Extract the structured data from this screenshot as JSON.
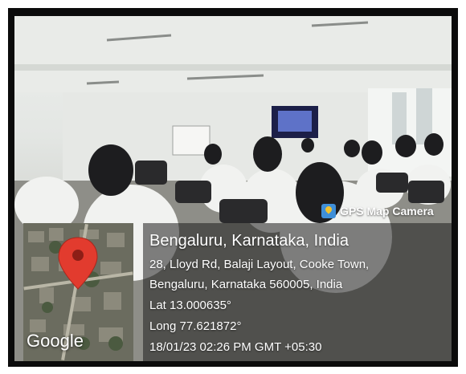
{
  "camera": {
    "app_name": "GPS Map Camera",
    "icon": "gps-map-camera-icon"
  },
  "map": {
    "provider_label": "Google",
    "pin_icon": "map-pin-icon",
    "pin_color": "#e23b2e"
  },
  "location": {
    "title": "Bengaluru, Karnataka, India",
    "address_line1": "28, Lloyd Rd, Balaji Layout, Cooke Town,",
    "address_line2": "Bengaluru, Karnataka 560005, India",
    "latitude": "Lat 13.000635°",
    "longitude": "Long 77.621872°",
    "datetime": "18/01/23 02:26 PM GMT +05:30"
  }
}
